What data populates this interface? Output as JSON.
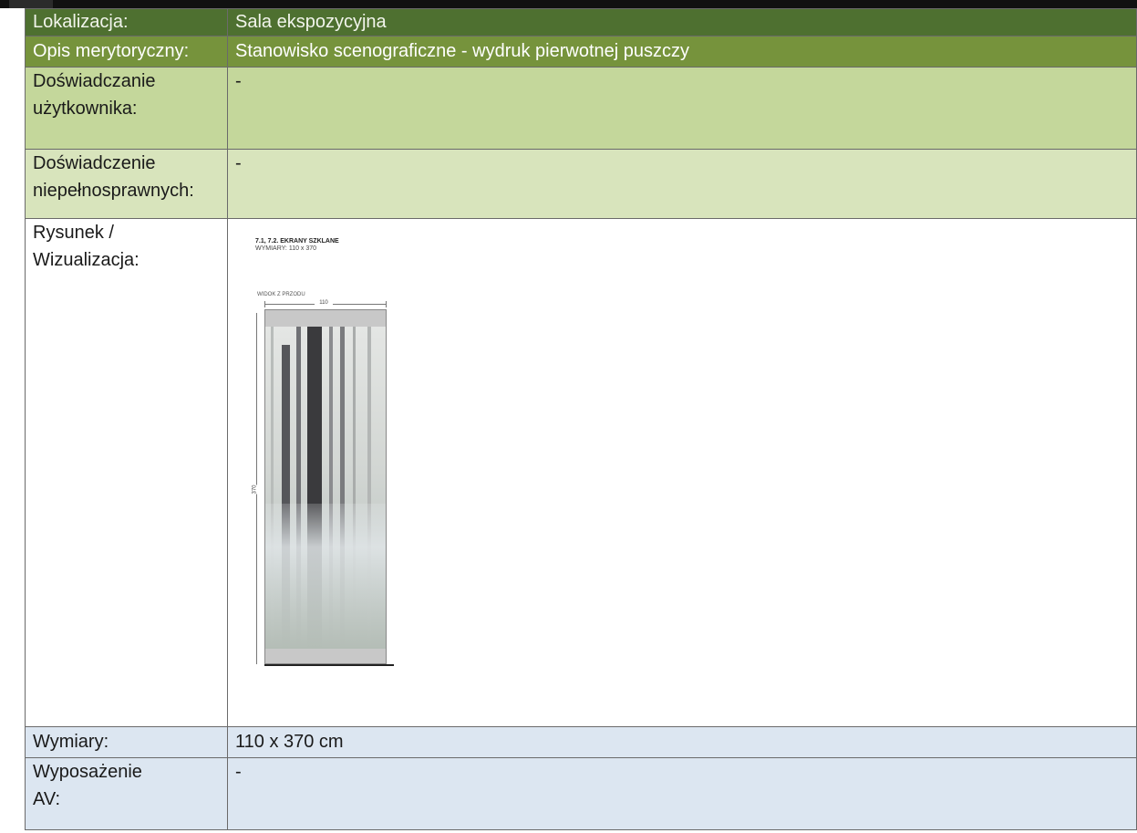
{
  "rows": {
    "lokalizacja": {
      "label": "Lokalizacja:",
      "value": "Sala ekspozycyjna"
    },
    "opis": {
      "label": "Opis merytoryczny:",
      "value": "Stanowisko scenograficzne - wydruk pierwotnej puszczy"
    },
    "doswiadczanie": {
      "label_line1": "Doświadczanie",
      "label_line2": "użytkownika:",
      "value": "-"
    },
    "niepelnosprawni": {
      "label_line1": "Doświadczenie",
      "label_line2": "niepełnosprawnych:",
      "value": "-"
    },
    "rysunek": {
      "label_line1": "Rysunek /",
      "label_line2": "Wizualizacja:"
    },
    "wymiary": {
      "label": "Wymiary:",
      "value": "110 x 370 cm"
    },
    "wyposazenie": {
      "label_line1": "Wyposażenie",
      "label_line2": "AV:",
      "value": "-"
    }
  },
  "drawing": {
    "title": "7.1, 7.2. EKRANY SZKLANE",
    "subtitle": "WYMIARY: 110 x 370",
    "view_label": "WIDOK Z PRZODU",
    "width_dim": "110",
    "height_dim": "370"
  },
  "colors": {
    "row_dark_green": "#4e7030",
    "row_green": "#76933c",
    "row_light_green": "#c4d79b",
    "row_pale_green": "#d8e4bc",
    "row_light_blue": "#dce6f1"
  }
}
